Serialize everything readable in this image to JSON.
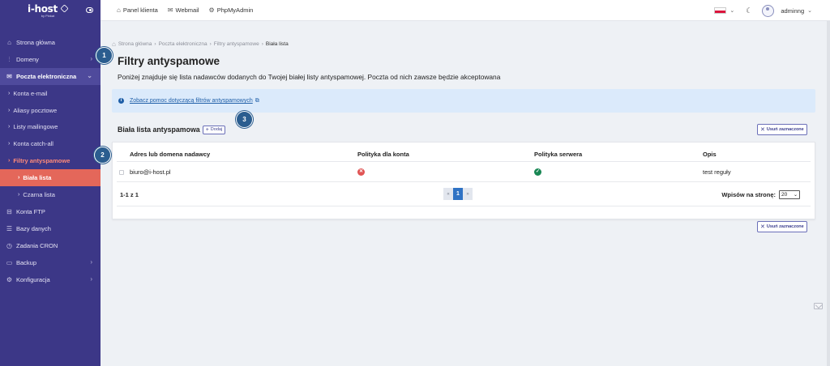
{
  "brand": {
    "name": "i-host",
    "tagline": "by Pinkat"
  },
  "topbar": {
    "links": [
      {
        "icon": "home-icon",
        "label": "Panel klienta"
      },
      {
        "icon": "mail-icon",
        "label": "Webmail"
      },
      {
        "icon": "gear-icon",
        "label": "PhpMyAdmin"
      }
    ],
    "user": "adminng"
  },
  "sidebar": {
    "items": [
      {
        "label": "Strona główna",
        "icon": "home-icon"
      },
      {
        "label": "Domeny",
        "icon": "bar-chart-icon"
      },
      {
        "label": "Poczta elektroniczna",
        "icon": "mail-icon"
      },
      {
        "label": "Konta e-mail"
      },
      {
        "label": "Aliasy pocztowe"
      },
      {
        "label": "Listy mailingowe"
      },
      {
        "label": "Konta catch-all"
      },
      {
        "label": "Filtry antyspamowe"
      },
      {
        "label": "Biała lista"
      },
      {
        "label": "Czarna lista"
      },
      {
        "label": "Konta FTP",
        "icon": "server-icon"
      },
      {
        "label": "Bazy danych",
        "icon": "database-icon"
      },
      {
        "label": "Zadania CRON",
        "icon": "clock-icon"
      },
      {
        "label": "Backup",
        "icon": "backup-icon"
      },
      {
        "label": "Konfiguracja",
        "icon": "settings-icon"
      }
    ]
  },
  "breadcrumb": {
    "items": [
      "Strona główna",
      "Poczta elektroniczna",
      "Filtry antyspamowe"
    ],
    "current": "Biała lista"
  },
  "page": {
    "title": "Filtry antyspamowe",
    "description": "Poniżej znajduje się lista nadawców dodanych do Twojej białej listy antyspamowej. Poczta od nich zawsze będzie akceptowana",
    "help_link": "Zobacz pomoc dotyczącą filtrów antyspamowych"
  },
  "whitelist": {
    "title": "Biała lista antyspamowa",
    "add_label": "Dodaj",
    "remove_label": "Usuń zaznaczone",
    "columns": [
      "Adres lub domena nadawcy",
      "Polityka dla konta",
      "Polityka serwera",
      "Opis"
    ],
    "rows": [
      {
        "sender": "biuro@i-host.pl",
        "account_policy": "blocked",
        "server_policy": "allowed",
        "description": "test reguły"
      }
    ],
    "range": "1-1 z 1",
    "pagination": {
      "prev": "«",
      "current": "1",
      "next": "»"
    },
    "per_page_label": "Wpisów na stronę:",
    "per_page_value": "20"
  },
  "badges": [
    "1",
    "2",
    "3"
  ],
  "colors": {
    "sidebar": "#3c3787",
    "active": "#e4675a",
    "badge": "#2b5d8f",
    "info": "#dbeafb"
  }
}
